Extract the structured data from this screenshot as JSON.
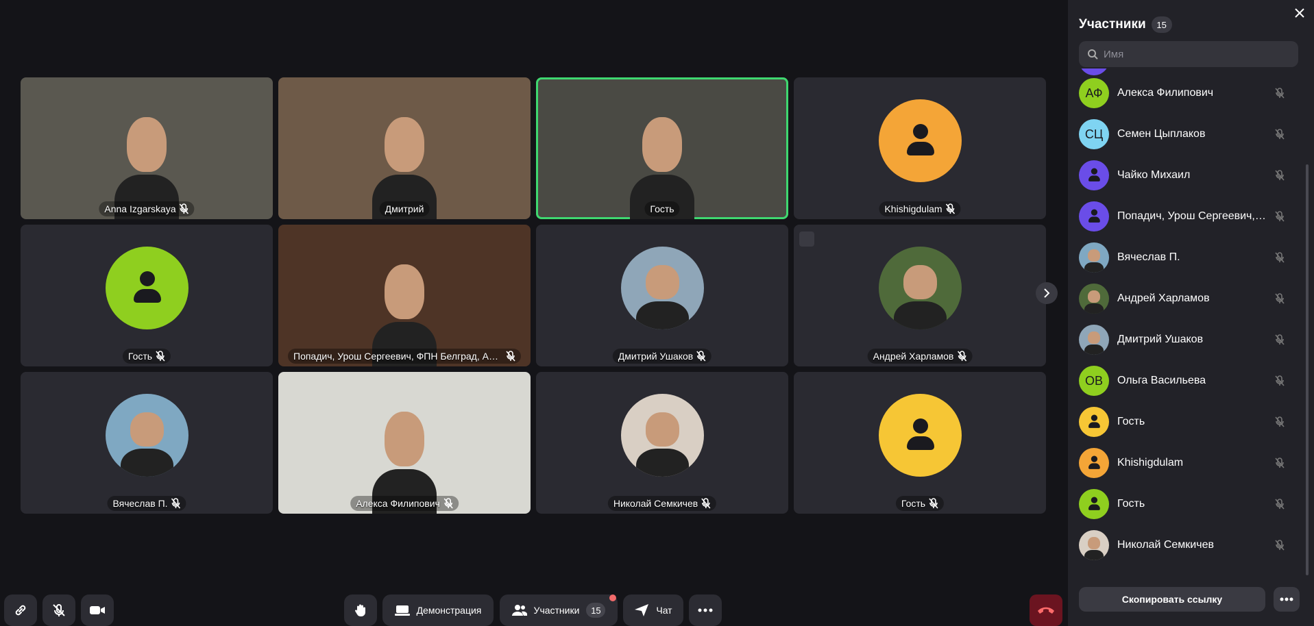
{
  "tiles": [
    {
      "name": "Anna Izgarskaya",
      "muted": true,
      "kind": "video",
      "bg": "#5a5850"
    },
    {
      "name": "Дмитрий",
      "muted": false,
      "kind": "video",
      "bg": "#6e5a48"
    },
    {
      "name": "Гость",
      "muted": false,
      "kind": "video",
      "bg": "#4a4a44",
      "active": true
    },
    {
      "name": "Khishigdulam",
      "muted": true,
      "kind": "avatar",
      "color": "#f4a537"
    },
    {
      "name": "Гость",
      "muted": true,
      "kind": "avatar",
      "color": "#8fcf1f"
    },
    {
      "name": "Попадич, Урош Сергеевич, ФПН Белград, Асп...",
      "muted": true,
      "kind": "video",
      "bg": "#4e3426"
    },
    {
      "name": "Дмитрий Ушаков",
      "muted": true,
      "kind": "photo",
      "color": "#8fa6b8"
    },
    {
      "name": "Андрей Харламов",
      "muted": true,
      "kind": "photo",
      "color": "#4f6a3a",
      "signal": true
    },
    {
      "name": "Вячеслав П.",
      "muted": true,
      "kind": "photo",
      "color": "#7fa8c2"
    },
    {
      "name": "Алекса Филипович",
      "muted": true,
      "kind": "video",
      "bg": "#d8d8d2"
    },
    {
      "name": "Николай Семкичев",
      "muted": true,
      "kind": "photo",
      "color": "#d9cfc4"
    },
    {
      "name": "Гость",
      "muted": true,
      "kind": "avatar",
      "color": "#f6c635"
    }
  ],
  "toolbar": {
    "demo_label": "Демонстрация",
    "participants_label": "Участники",
    "participants_count": "15",
    "chat_label": "Чат"
  },
  "panel": {
    "title": "Участники",
    "count": "15",
    "search_placeholder": "Имя",
    "copy_link_label": "Скопировать ссылку",
    "participants": [
      {
        "name": "Алекса Филипович",
        "initials": "АФ",
        "color": "#8fcf1f",
        "kind": "initials"
      },
      {
        "name": "Семен Цыплаков",
        "initials": "СЦ",
        "color": "#7fd4f2",
        "kind": "initials"
      },
      {
        "name": "Чайко Михаил",
        "initials": "",
        "color": "#6a4de8",
        "kind": "glyph"
      },
      {
        "name": "Попадич, Урош Сергеевич, ФПН Белград, Асп...",
        "initials": "",
        "color": "#6a4de8",
        "kind": "glyph"
      },
      {
        "name": "Вячеслав П.",
        "initials": "",
        "color": "#7fa8c2",
        "kind": "photo"
      },
      {
        "name": "Андрей Харламов",
        "initials": "",
        "color": "#4f6a3a",
        "kind": "photo"
      },
      {
        "name": "Дмитрий Ушаков",
        "initials": "",
        "color": "#8fa6b8",
        "kind": "photo"
      },
      {
        "name": "Ольга Васильева",
        "initials": "ОВ",
        "color": "#8fcf1f",
        "kind": "initials"
      },
      {
        "name": "Гость",
        "initials": "",
        "color": "#f6c635",
        "kind": "glyph"
      },
      {
        "name": "Khishigdulam",
        "initials": "",
        "color": "#f4a537",
        "kind": "glyph"
      },
      {
        "name": "Гость",
        "initials": "",
        "color": "#8fcf1f",
        "kind": "glyph"
      },
      {
        "name": "Николай Семкичев",
        "initials": "",
        "color": "#d9cfc4",
        "kind": "photo"
      }
    ]
  }
}
